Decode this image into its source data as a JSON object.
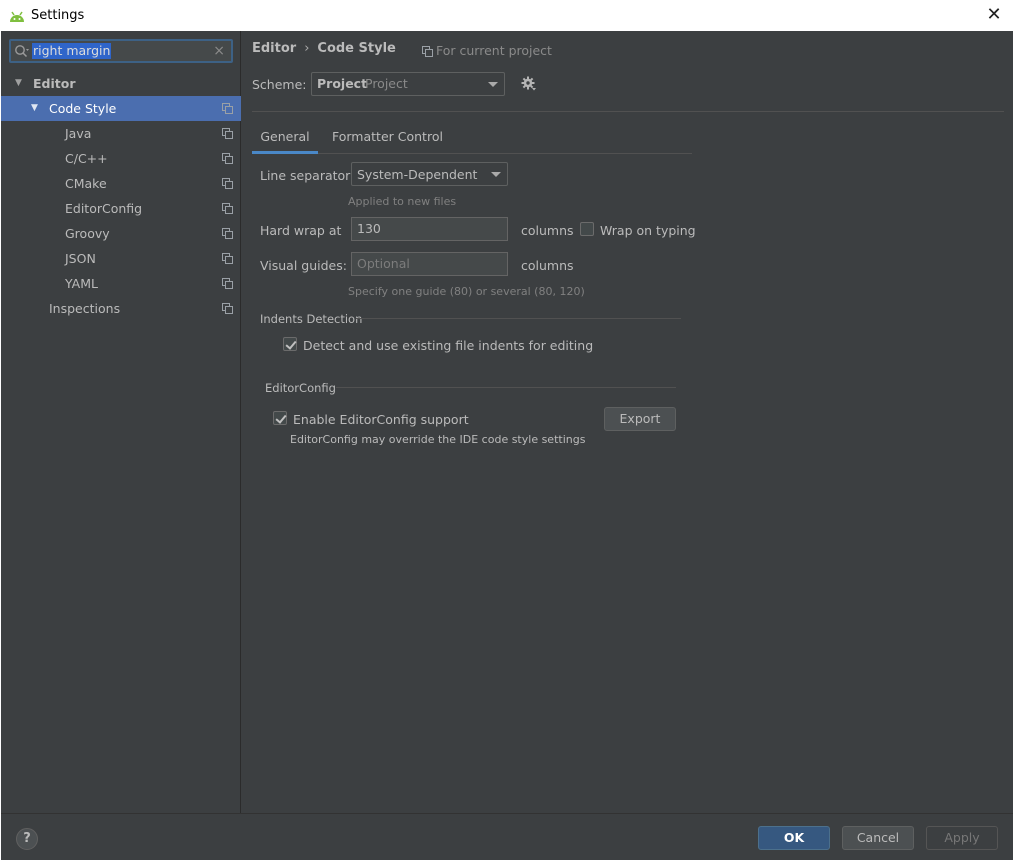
{
  "window": {
    "title": "Settings",
    "close_glyph": "✕"
  },
  "search": {
    "value": "right margin",
    "clear_glyph": "×"
  },
  "tree": {
    "items": [
      {
        "label": "Editor",
        "level": 0,
        "arrow": "▼",
        "copy": false,
        "selected": false
      },
      {
        "label": "Code Style",
        "level": 1,
        "arrow": "▼",
        "copy": true,
        "selected": true
      },
      {
        "label": "Java",
        "level": 2,
        "copy": true
      },
      {
        "label": "C/C++",
        "level": 2,
        "copy": true
      },
      {
        "label": "CMake",
        "level": 2,
        "copy": true
      },
      {
        "label": "EditorConfig",
        "level": 2,
        "copy": true
      },
      {
        "label": "Groovy",
        "level": 2,
        "copy": true
      },
      {
        "label": "JSON",
        "level": 2,
        "copy": true
      },
      {
        "label": "YAML",
        "level": 2,
        "copy": true
      },
      {
        "label": "Inspections",
        "level": 1,
        "copy": true
      }
    ]
  },
  "breadcrumb": {
    "part1": "Editor",
    "sep": "›",
    "part2": "Code Style",
    "scope_note": "For current project"
  },
  "scheme": {
    "label": "Scheme:",
    "value_bold": "Project",
    "value_name": "Project"
  },
  "tabs": [
    {
      "label": "General",
      "active": true
    },
    {
      "label": "Formatter Control",
      "active": false
    }
  ],
  "general": {
    "line_separator": {
      "label": "Line separator:",
      "value": "System-Dependent",
      "hint": "Applied to new files"
    },
    "hard_wrap": {
      "label": "Hard wrap at",
      "value": "130",
      "unit": "columns",
      "wrap_on_typing_label": "Wrap on typing",
      "wrap_on_typing_checked": false
    },
    "visual_guides": {
      "label": "Visual guides:",
      "placeholder": "Optional",
      "unit": "columns",
      "hint": "Specify one guide (80) or several (80, 120)"
    },
    "indents_detection": {
      "title": "Indents Detection",
      "checkbox_label": "Detect and use existing file indents for editing",
      "checked": true
    },
    "editorconfig": {
      "title": "EditorConfig",
      "checkbox_label": "Enable EditorConfig support",
      "checked": true,
      "note": "EditorConfig may override the IDE code style settings",
      "export_label": "Export"
    }
  },
  "footer": {
    "help": "?",
    "ok": "OK",
    "cancel": "Cancel",
    "apply": "Apply"
  },
  "colors": {
    "background": "#3c3f41",
    "selection": "#4b6eaf",
    "accent": "#4a88c7",
    "ok_button": "#365880"
  }
}
